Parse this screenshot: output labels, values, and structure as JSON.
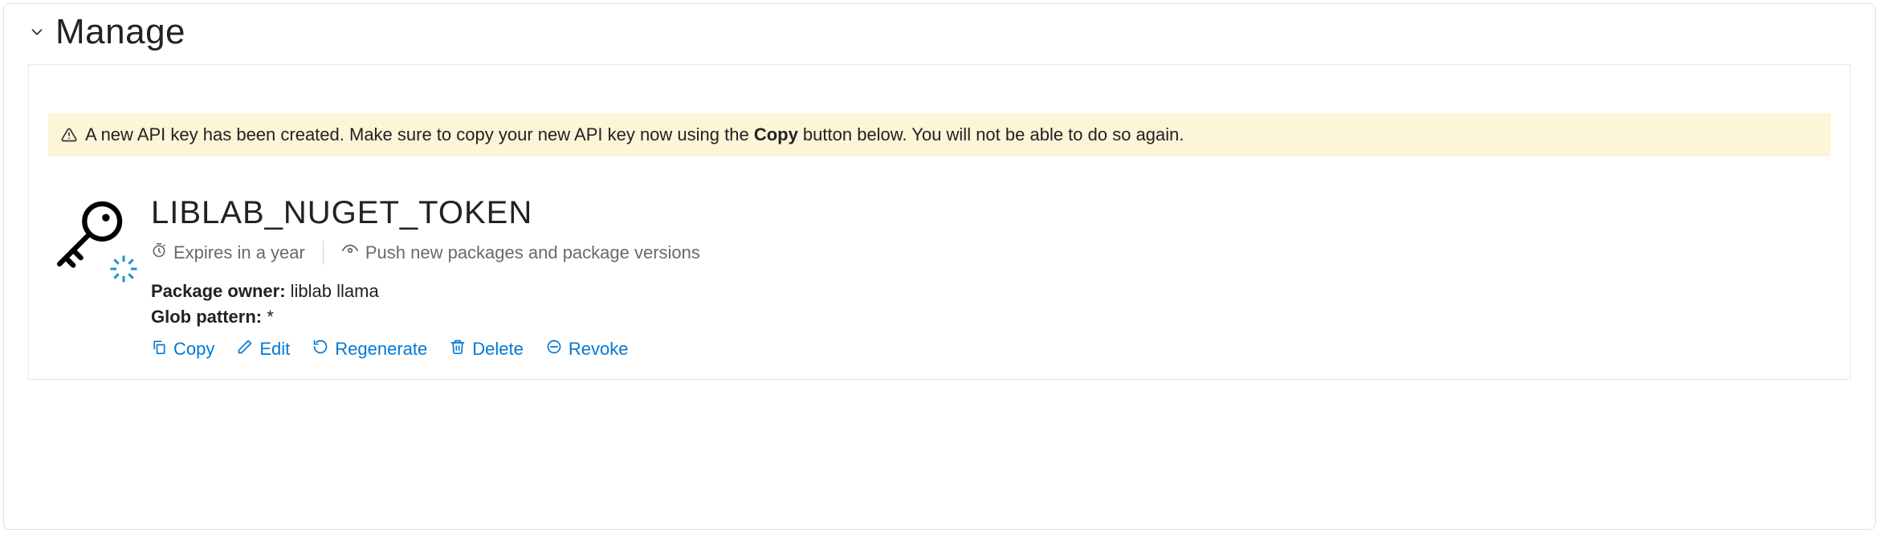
{
  "section": {
    "title": "Manage"
  },
  "warning": {
    "prefix": "A new API key has been created. Make sure to copy your new API key now using the ",
    "bold": "Copy",
    "suffix": " button below. You will not be able to do so again."
  },
  "key": {
    "name": "LIBLAB_NUGET_TOKEN",
    "expires_text": "Expires in a year",
    "scope_text": "Push new packages and package versions",
    "owner_label": "Package owner:",
    "owner_value": "liblab llama",
    "glob_label": "Glob pattern:",
    "glob_value": "*"
  },
  "actions": {
    "copy": "Copy",
    "edit": "Edit",
    "regenerate": "Regenerate",
    "delete": "Delete",
    "revoke": "Revoke"
  }
}
